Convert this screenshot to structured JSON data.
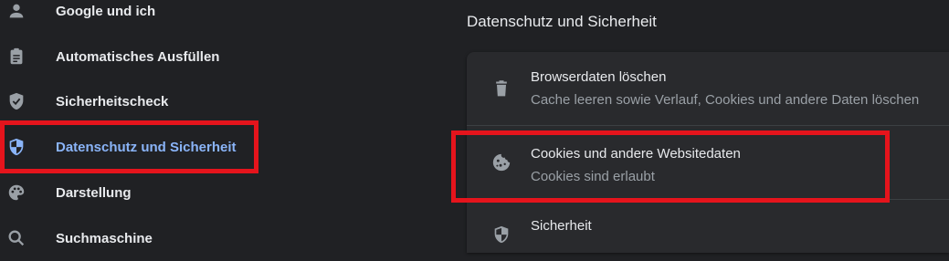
{
  "sidebar": {
    "items": [
      {
        "label": "Google und ich",
        "icon": "person-icon",
        "active": false
      },
      {
        "label": "Automatisches Ausfüllen",
        "icon": "clipboard-icon",
        "active": false
      },
      {
        "label": "Sicherheitscheck",
        "icon": "shield-check-icon",
        "active": false
      },
      {
        "label": "Datenschutz und Sicherheit",
        "icon": "privacy-shield-icon",
        "active": true
      },
      {
        "label": "Darstellung",
        "icon": "palette-icon",
        "active": false
      },
      {
        "label": "Suchmaschine",
        "icon": "search-icon",
        "active": false
      }
    ]
  },
  "main": {
    "section_title": "Datenschutz und Sicherheit",
    "rows": [
      {
        "title": "Browserdaten löschen",
        "subtitle": "Cache leeren sowie Verlauf, Cookies und andere Daten löschen",
        "icon": "trash-icon"
      },
      {
        "title": "Cookies und andere Websitedaten",
        "subtitle": "Cookies sind erlaubt",
        "icon": "cookie-icon"
      },
      {
        "title": "Sicherheit",
        "icon": "shield-icon"
      }
    ]
  },
  "colors": {
    "background": "#202124",
    "card": "#292a2d",
    "active_text": "#8ab4f8",
    "highlight": "#e5141c"
  }
}
